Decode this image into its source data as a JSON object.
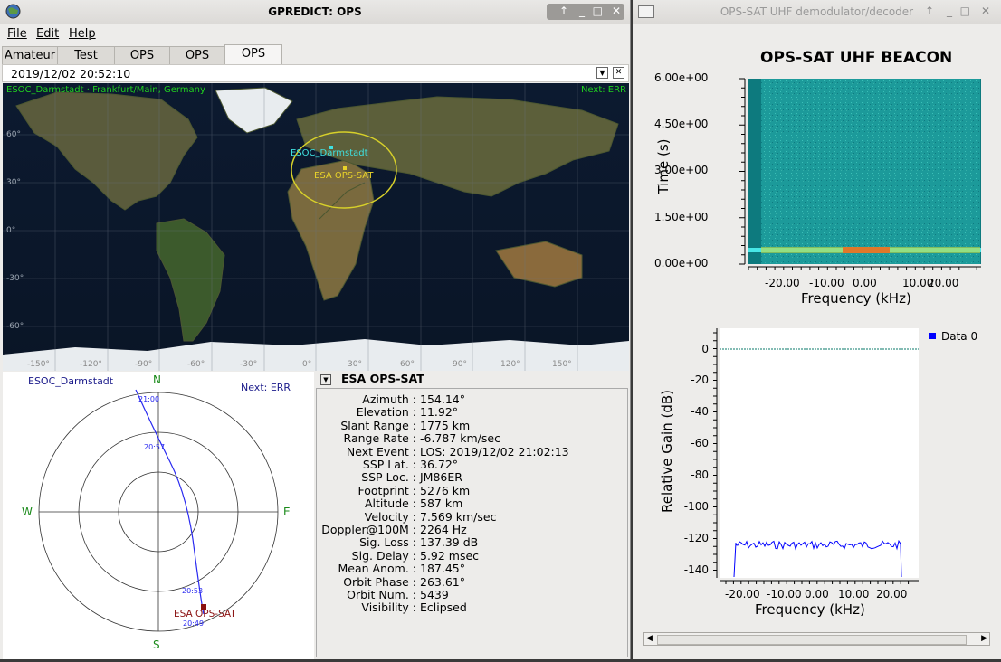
{
  "gpredict": {
    "title": "GPREDICT: OPS",
    "menu": [
      "File",
      "Edit",
      "Help"
    ],
    "tabs": [
      "Amateur",
      "Test",
      "OPS",
      "OPS",
      "OPS"
    ],
    "time": "2019/12/02 20:52:10",
    "map": {
      "qth": "ESOC_Darmstadt · Frankfurt/Main, Germany",
      "next": "Next: ERR",
      "station_label": "ESOC_Darmstadt",
      "sat_label": "ESA OPS-SAT",
      "lat_labels": [
        "60°",
        "30°",
        "0°",
        "-30°",
        "-60°"
      ],
      "lon_labels": [
        "-150°",
        "-120°",
        "-90°",
        "-60°",
        "-30°",
        "0°",
        "30°",
        "60°",
        "90°",
        "120°",
        "150°"
      ]
    },
    "polar": {
      "station": "ESOC_Darmstadt",
      "next": "Next: ERR",
      "n": "N",
      "s": "S",
      "e": "E",
      "w": "W",
      "times": [
        "21:00",
        "20:57",
        "20:53",
        "20:49"
      ],
      "sat": "ESA OPS-SAT"
    },
    "info": {
      "title": "ESA OPS-SAT",
      "rows": [
        {
          "k": "Azimuth :",
          "v": "154.14°"
        },
        {
          "k": "Elevation :",
          "v": "11.92°"
        },
        {
          "k": "Slant Range :",
          "v": "1775 km"
        },
        {
          "k": "Range Rate :",
          "v": "-6.787 km/sec"
        },
        {
          "k": "Next Event :",
          "v": "LOS: 2019/12/02 21:02:13"
        },
        {
          "k": "SSP Lat. :",
          "v": "36.72°"
        },
        {
          "k": "SSP Loc. :",
          "v": "JM86ER"
        },
        {
          "k": "Footprint :",
          "v": "5276 km"
        },
        {
          "k": "Altitude :",
          "v": "587 km"
        },
        {
          "k": "Velocity :",
          "v": "7.569 km/sec"
        },
        {
          "k": "Doppler@100M :",
          "v": "2264 Hz"
        },
        {
          "k": "Sig. Loss :",
          "v": "137.39 dB"
        },
        {
          "k": "Sig. Delay :",
          "v": "5.92 msec"
        },
        {
          "k": "Mean Anom. :",
          "v": "187.45°"
        },
        {
          "k": "Orbit Phase :",
          "v": "263.61°"
        },
        {
          "k": "Orbit Num. :",
          "v": "5439"
        },
        {
          "k": "Visibility :",
          "v": "Eclipsed"
        }
      ]
    }
  },
  "opssat": {
    "title": "OPS-SAT UHF demodulator/decoder",
    "waterfall": {
      "title": "OPS-SAT UHF BEACON",
      "ylabel": "Time (s)",
      "xlabel": "Frequency (kHz)",
      "yticks": [
        "6.00e+00",
        "4.50e+00",
        "3.00e+00",
        "1.50e+00",
        "0.00e+00"
      ],
      "xticks": [
        "-20.00",
        "-10.00",
        "0.00",
        "10.00",
        "20.00"
      ]
    },
    "spectrum": {
      "ylabel": "Relative Gain (dB)",
      "xlabel": "Frequency (kHz)",
      "legend": "Data 0",
      "yticks": [
        "0",
        "-20",
        "-40",
        "-60",
        "-80",
        "-100",
        "-120",
        "-140"
      ],
      "xticks": [
        "-20.00",
        "-10.00",
        "0.00",
        "10.00",
        "20.00"
      ]
    },
    "color_series": "#0000ff",
    "scroll_left": "◀",
    "scroll_right": "▶"
  }
}
